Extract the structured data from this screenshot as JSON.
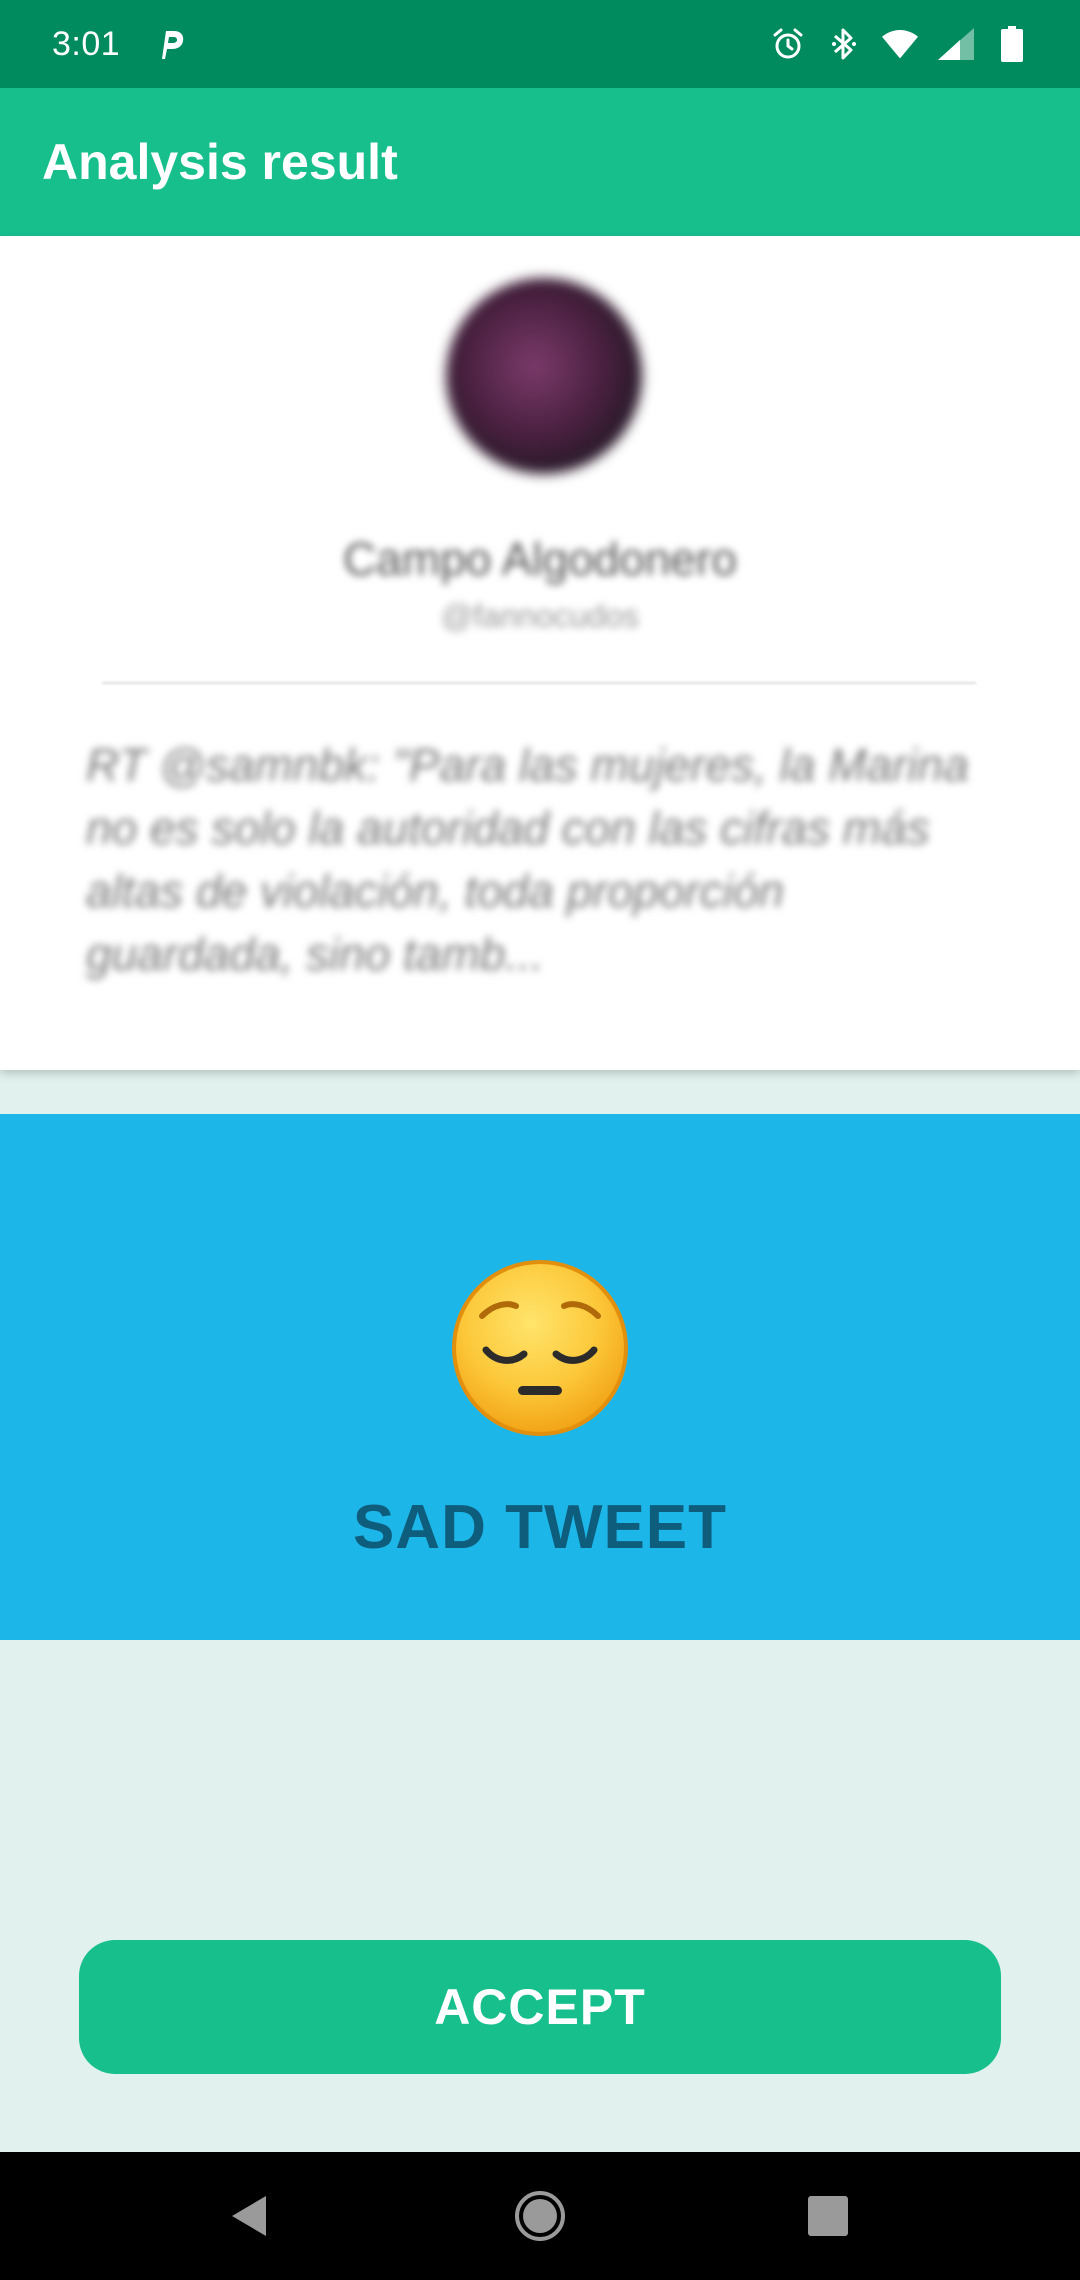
{
  "status_bar": {
    "time": "3:01",
    "icons": [
      "parking-app-icon",
      "alarm-icon",
      "bluetooth-icon",
      "wifi-icon",
      "signal-icon",
      "battery-icon"
    ]
  },
  "app_bar": {
    "title": "Analysis result"
  },
  "tweet": {
    "user_name": "Campo Algodonero",
    "user_handle": "@fannocudos",
    "text": "RT @samnbk: \"Para las mujeres, la Marina no es solo la autoridad con las cifras más altas de violación, toda proporción guardada, sino tamb..."
  },
  "result": {
    "emoji": "pensive-face",
    "label": "SAD TWEET"
  },
  "actions": {
    "accept_label": "ACCEPT"
  },
  "nav_bar": {
    "icons": [
      "back-icon",
      "home-icon",
      "recents-icon"
    ]
  },
  "colors": {
    "status_bar": "#008b5e",
    "app_bar": "#16bf8c",
    "background": "#e1f2ee",
    "result_panel": "#1db6e8",
    "result_text": "#0e5d7c",
    "accept_button": "#16bf8c"
  }
}
